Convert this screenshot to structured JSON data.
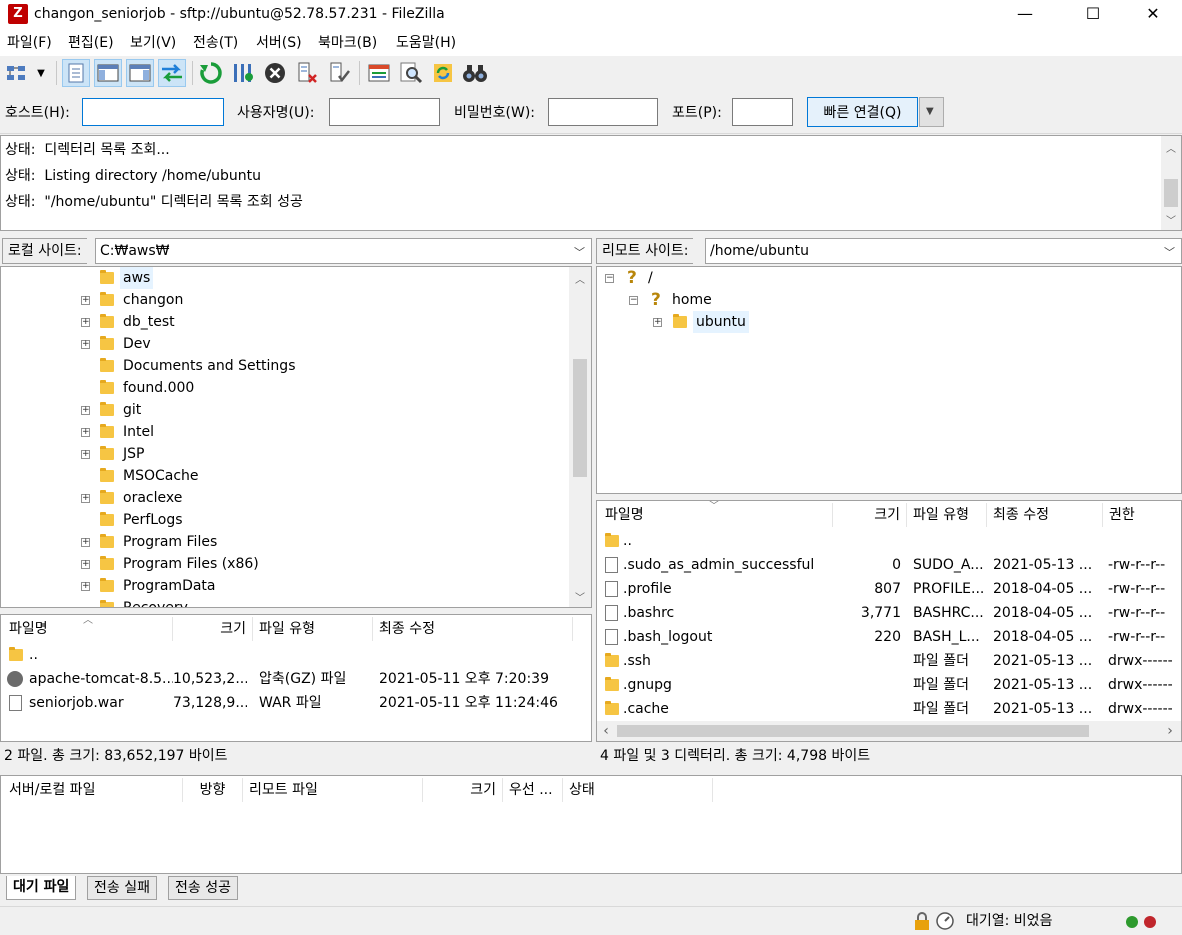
{
  "window": {
    "title": "changon_seniorjob - sftp://ubuntu@52.78.57.231 - FileZilla",
    "app_icon": "Z",
    "minimize": "—",
    "maximize": "☐",
    "close": "✕"
  },
  "menu": [
    "파일(F)",
    "편집(E)",
    "보기(V)",
    "전송(T)",
    "서버(S)",
    "북마크(B)",
    "도움말(H)"
  ],
  "quickconnect": {
    "host_label": "호스트(H):",
    "host_value": "",
    "user_label": "사용자명(U):",
    "user_value": "",
    "pass_label": "비밀번호(W):",
    "pass_value": "",
    "port_label": "포트(P):",
    "port_value": "",
    "button": "빠른 연결(Q)"
  },
  "log": [
    {
      "prefix": "상태:",
      "text": "디렉터리 목록 조회..."
    },
    {
      "prefix": "상태:",
      "text": "Listing directory /home/ubuntu"
    },
    {
      "prefix": "상태:",
      "text": "\"/home/ubuntu\" 디렉터리 목록 조회 성공"
    }
  ],
  "local": {
    "site_label": "로컬 사이트:",
    "path": "C:₩aws₩",
    "tree": [
      {
        "name": "aws",
        "expander": false,
        "selected": true
      },
      {
        "name": "changon",
        "expander": true
      },
      {
        "name": "db_test",
        "expander": true
      },
      {
        "name": "Dev",
        "expander": true
      },
      {
        "name": "Documents and Settings",
        "expander": false
      },
      {
        "name": "found.000",
        "expander": false
      },
      {
        "name": "git",
        "expander": true
      },
      {
        "name": "Intel",
        "expander": true
      },
      {
        "name": "JSP",
        "expander": true
      },
      {
        "name": "MSOCache",
        "expander": false
      },
      {
        "name": "oraclexe",
        "expander": true
      },
      {
        "name": "PerfLogs",
        "expander": false
      },
      {
        "name": "Program Files",
        "expander": true
      },
      {
        "name": "Program Files (x86)",
        "expander": true
      },
      {
        "name": "ProgramData",
        "expander": true
      },
      {
        "name": "Recovery",
        "expander": false
      }
    ],
    "columns": [
      "파일명",
      "크기",
      "파일 유형",
      "최종 수정"
    ],
    "files": [
      {
        "name": "..",
        "size": "",
        "type": "",
        "modified": "",
        "icon": "folder"
      },
      {
        "name": "apache-tomcat-8.5....",
        "size": "10,523,2...",
        "type": "압축(GZ) 파일",
        "modified": "2021-05-11 오후 7:20:39",
        "icon": "gz"
      },
      {
        "name": "seniorjob.war",
        "size": "73,128,9...",
        "type": "WAR 파일",
        "modified": "2021-05-11 오후 11:24:46",
        "icon": "file"
      }
    ],
    "status": "2 파일. 총 크기: 83,652,197 바이트"
  },
  "remote": {
    "site_label": "리모트 사이트:",
    "path": "/home/ubuntu",
    "tree": [
      {
        "name": "/",
        "icon": "question",
        "level": 0,
        "expander": "⊟"
      },
      {
        "name": "home",
        "icon": "question",
        "level": 1,
        "expander": "⊟"
      },
      {
        "name": "ubuntu",
        "icon": "folder",
        "level": 2,
        "expander": "⊞",
        "selected": true
      }
    ],
    "columns": [
      "파일명",
      "크기",
      "파일 유형",
      "최종 수정",
      "권한"
    ],
    "files": [
      {
        "name": "..",
        "size": "",
        "type": "",
        "modified": "",
        "perm": "",
        "icon": "folder"
      },
      {
        "name": ".sudo_as_admin_successful",
        "size": "0",
        "type": "SUDO_A...",
        "modified": "2021-05-13 ...",
        "perm": "-rw-r--r--",
        "icon": "file"
      },
      {
        "name": ".profile",
        "size": "807",
        "type": "PROFILE...",
        "modified": "2018-04-05 ...",
        "perm": "-rw-r--r--",
        "icon": "file"
      },
      {
        "name": ".bashrc",
        "size": "3,771",
        "type": "BASHRC...",
        "modified": "2018-04-05 ...",
        "perm": "-rw-r--r--",
        "icon": "file"
      },
      {
        "name": ".bash_logout",
        "size": "220",
        "type": "BASH_L...",
        "modified": "2018-04-05 ...",
        "perm": "-rw-r--r--",
        "icon": "file"
      },
      {
        "name": ".ssh",
        "size": "",
        "type": "파일 폴더",
        "modified": "2021-05-13 ...",
        "perm": "drwx------",
        "icon": "folder"
      },
      {
        "name": ".gnupg",
        "size": "",
        "type": "파일 폴더",
        "modified": "2021-05-13 ...",
        "perm": "drwx------",
        "icon": "folder"
      },
      {
        "name": ".cache",
        "size": "",
        "type": "파일 폴더",
        "modified": "2021-05-13 ...",
        "perm": "drwx------",
        "icon": "folder"
      }
    ],
    "status": "4 파일 및 3 디렉터리. 총 크기: 4,798 바이트"
  },
  "queue": {
    "columns": [
      "서버/로컬 파일",
      "방향",
      "리모트 파일",
      "크기",
      "우선 ...",
      "상태"
    ],
    "tabs": [
      "대기 파일",
      "전송 실패",
      "전송 성공"
    ],
    "status": "대기열: 비었음"
  },
  "colors": {
    "accent": "#0078d7",
    "led_green": "#2e9a2e",
    "led_red": "#c0262c"
  }
}
